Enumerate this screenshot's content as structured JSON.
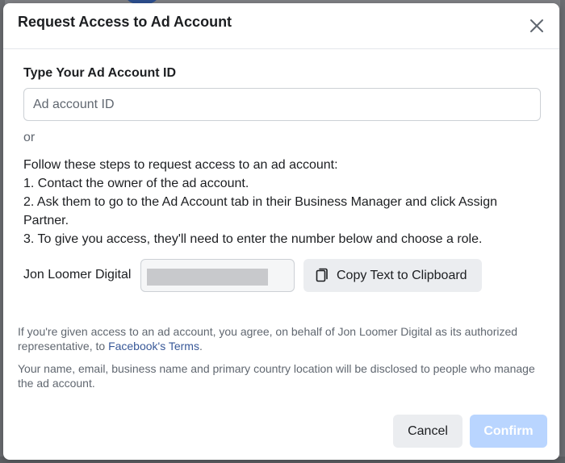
{
  "dialog": {
    "title": "Request Access to Ad Account",
    "field_label": "Type Your Ad Account ID",
    "input_placeholder": "Ad account ID",
    "input_value": "",
    "or_text": "or",
    "steps": [
      "Follow these steps to request access to an ad account:",
      "1. Contact the owner of the ad account.",
      "2. Ask them to go to the Ad Account tab in their Business Manager and click Assign Partner.",
      "3. To give you access, they'll need to enter the number below and choose a role."
    ],
    "partner_name": "Jon Loomer Digital",
    "copy_button_label": "Copy Text to Clipboard",
    "agreement_text": "If you're given access to an ad account, you agree, on behalf of Jon Loomer Digital as its authorized representative, to ",
    "terms_link": "Facebook's Terms",
    "agreement_end": ".",
    "disclosure_text": "Your name, email, business name and primary country location will be disclosed to people who manage the ad account.",
    "cancel_label": "Cancel",
    "confirm_label": "Confirm"
  },
  "colors": {
    "link": "#385898",
    "confirm_disabled_bg": "#b9d5ff",
    "secondary_button_bg": "#ebedf0"
  },
  "icons": {
    "close": "close-icon",
    "copy": "copy-icon"
  }
}
